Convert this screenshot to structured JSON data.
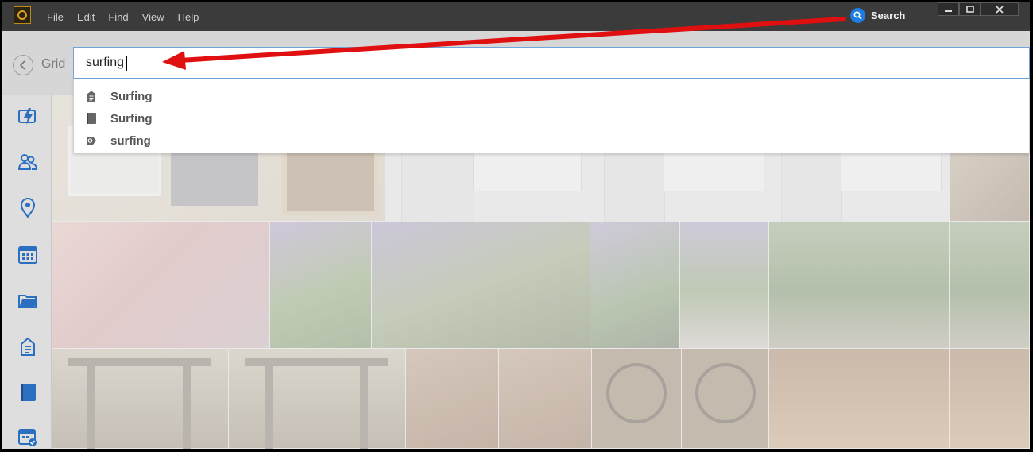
{
  "menu": [
    "File",
    "Edit",
    "Find",
    "View",
    "Help"
  ],
  "search_button_label": "Search",
  "window_controls": [
    "minimize",
    "maximize",
    "close"
  ],
  "grid_label": "Grid",
  "search": {
    "value": "surfing"
  },
  "suggestions": [
    {
      "label": "Surfing",
      "icon": "tag-icon"
    },
    {
      "label": "Surfing",
      "icon": "album-icon"
    },
    {
      "label": "surfing",
      "icon": "search-history-icon"
    }
  ],
  "sidebar_icons": [
    "instant-fix-icon",
    "people-icon",
    "places-icon",
    "events-calendar-icon",
    "folder-icon",
    "keyword-tag-icon",
    "album-icon",
    "saved-search-calendar-icon"
  ],
  "colors": {
    "accent": "#1b7ee0",
    "annotation_arrow": "#e01010",
    "titlebar": "#3b3b3b"
  }
}
